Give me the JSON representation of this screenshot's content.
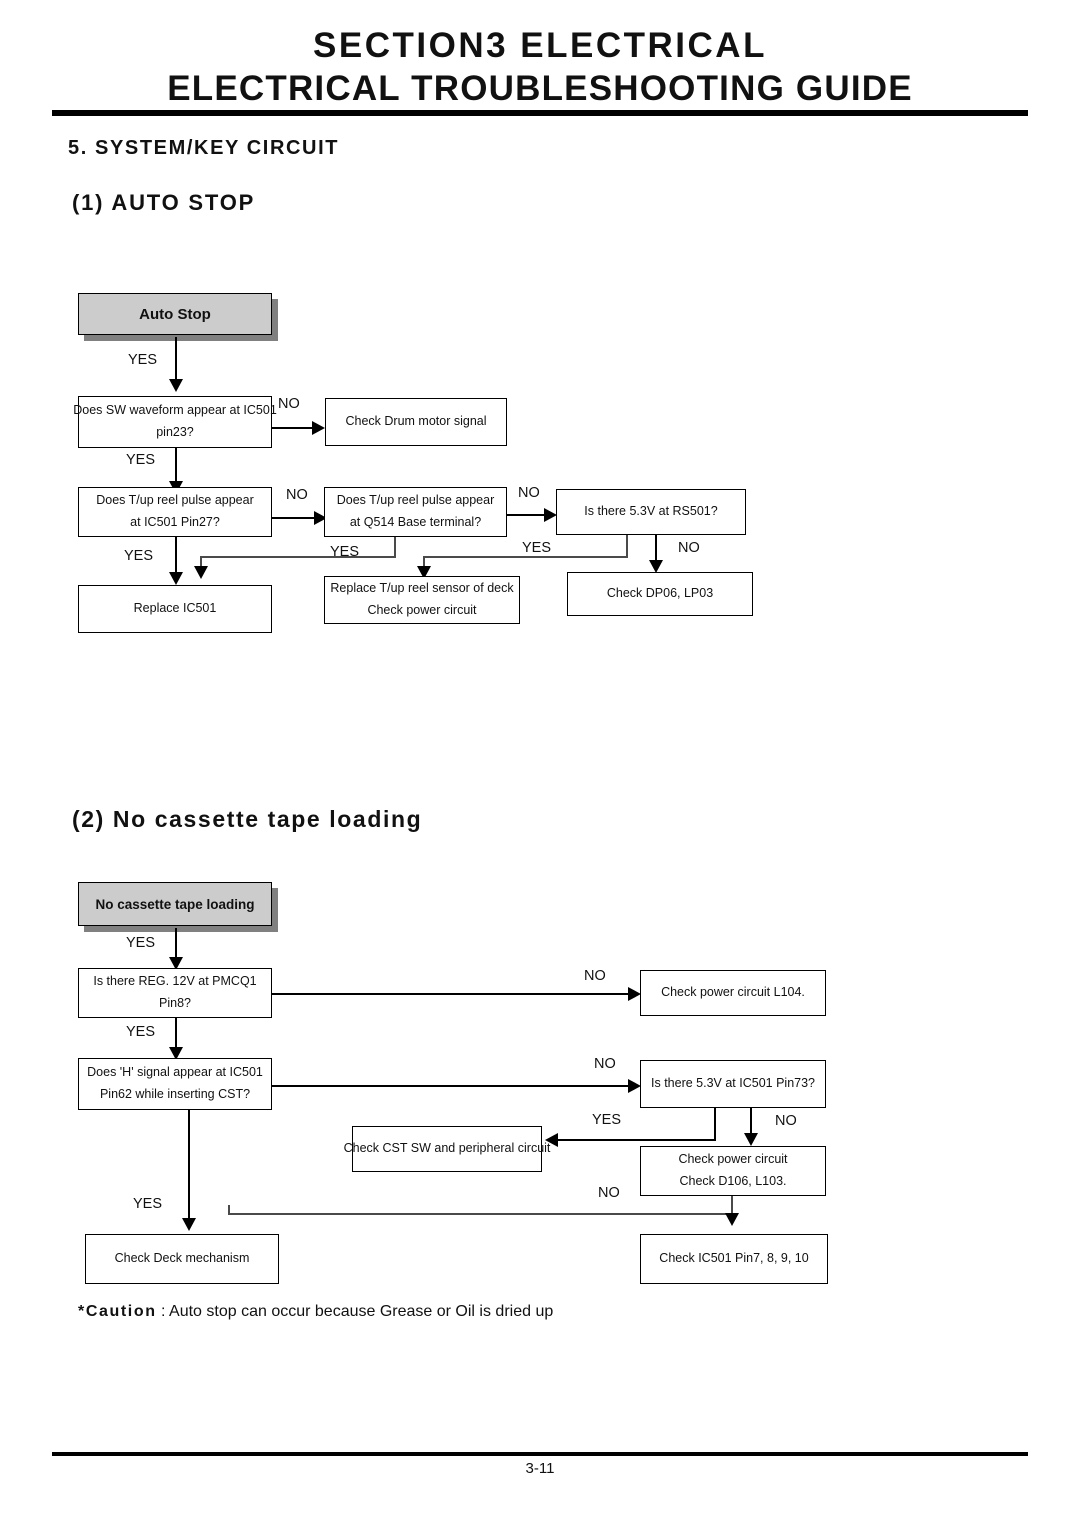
{
  "header": {
    "title_line1": "SECTION3   ELECTRICAL",
    "title_line2": "ELECTRICAL TROUBLESHOOTING GUIDE"
  },
  "headings": {
    "section5": "5. SYSTEM/KEY CIRCUIT",
    "sub1": "(1) AUTO STOP",
    "sub2": "(2) No cassette tape loading"
  },
  "labels": {
    "yes": "YES",
    "no": "NO"
  },
  "chart1": {
    "start": "Auto Stop",
    "d1_line1": "Does SW waveform appear at IC501",
    "d1_line2": "pin23?",
    "r1": "Check Drum motor signal",
    "d2_line1": "Does T/up reel pulse appear",
    "d2_line2": "at IC501 Pin27?",
    "d3_line1": "Does T/up reel pulse appear",
    "d3_line2": "at Q514 Base terminal?",
    "d4": "Is there 5.3V at RS501?",
    "t1": "Replace IC501",
    "t2_line1": "Replace T/up reel sensor of  deck",
    "t2_line2": "Check power circuit",
    "t3": "Check DP06, LP03",
    "yes_1": "YES",
    "yes_2": "YES",
    "yes_3": "YES",
    "yes_4": "YES",
    "yes_5": "YES",
    "no_1": "NO",
    "no_2": "NO",
    "no_3": "NO",
    "no_4": "NO"
  },
  "chart2": {
    "start": "No cassette tape loading",
    "d1_line1": "Is there REG. 12V at PMCQ1",
    "d1_line2": "Pin8?",
    "r1": "Check power circuit L104.",
    "d2_line1": "Does 'H' signal appear at IC501",
    "d2_line2": "Pin62 while inserting CST?",
    "d3": "Is there 5.3V at IC501 Pin73?",
    "t1": "Check CST SW and  peripheral circuit",
    "t2_line1": "Check power circuit",
    "t2_line2": "Check D106, L103.",
    "t3": "Check Deck mechanism",
    "t4": "Check IC501 Pin7, 8, 9, 10",
    "yes_1": "YES",
    "yes_2": "YES",
    "yes_3": "YES",
    "no_1": "NO",
    "no_2": "NO",
    "no_3": "NO",
    "no_4": "NO"
  },
  "caution": {
    "prefix": "*Caution",
    "text": " : Auto stop can occur because Grease or Oil is dried up"
  },
  "footer": {
    "page": "3-11"
  }
}
